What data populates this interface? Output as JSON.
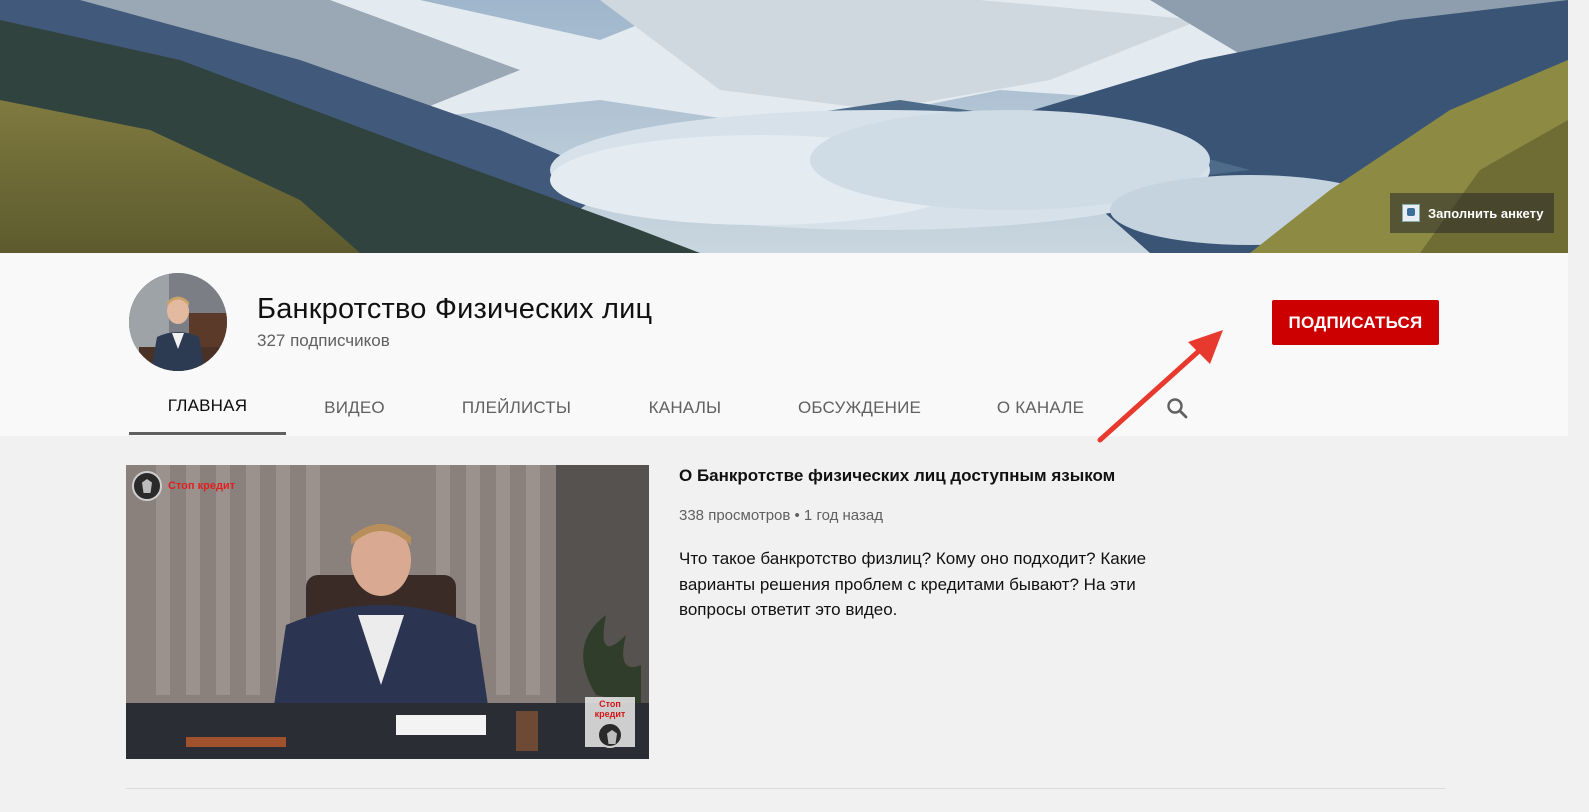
{
  "banner": {
    "survey_link_label": "Заполнить анкету"
  },
  "channel": {
    "title": "Банкротство Физических лиц",
    "subscribers": "327 подписчиков",
    "subscribe_label": "ПОДПИСАТЬСЯ"
  },
  "tabs": [
    {
      "label": "ГЛАВНАЯ",
      "active": true
    },
    {
      "label": "ВИДЕО",
      "active": false
    },
    {
      "label": "ПЛЕЙЛИСТЫ",
      "active": false
    },
    {
      "label": "КАНАЛЫ",
      "active": false
    },
    {
      "label": "ОБСУЖДЕНИЕ",
      "active": false
    },
    {
      "label": "О КАНАЛЕ",
      "active": false
    }
  ],
  "featured_video": {
    "thumb_brand": "Стоп кредит",
    "thumb_badge": "Стоп кредит",
    "title": "О Банкротстве физических лиц доступным языком",
    "meta": "338 просмотров • 1 год назад",
    "description": "Что такое банкротство физлиц? Кому оно подходит? Какие варианты решения проблем с кредитами бывают? На эти вопросы ответит это видео."
  },
  "colors": {
    "subscribe_red": "#cc0000",
    "arrow_red": "#e8392e",
    "page_bg": "#f1f1f1",
    "header_bg": "#f9f9f9"
  },
  "icons": {
    "tab_search": "search-icon",
    "survey_logo": "survey-logo-icon",
    "brand_logo": "shield-logo-icon"
  }
}
